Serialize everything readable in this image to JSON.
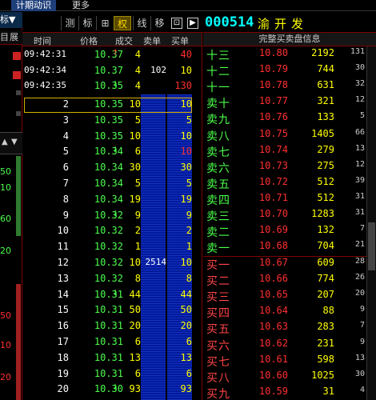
{
  "menubar": {
    "items": [
      {
        "label": "计期动识",
        "selected": true
      },
      {
        "label": "更多",
        "selected": false
      }
    ]
  },
  "left_strip": {
    "top_label": "标▼",
    "headers": [
      "目",
      "展"
    ],
    "values": [
      "50",
      "10",
      "60",
      "20",
      "50",
      "10",
      "20"
    ],
    "scroll_arrows": [
      "▲",
      "▼"
    ]
  },
  "toolbar": {
    "buttons": [
      "测",
      "标",
      "⊞",
      "权",
      "线",
      "移"
    ],
    "active": "权",
    "box_icons": [
      "⊡",
      "▶"
    ]
  },
  "stock": {
    "code": "000514",
    "name": "渝开发"
  },
  "tick_table": {
    "headers": [
      "时间",
      "价格",
      "成交",
      "卖单",
      "买单"
    ],
    "time_rows": [
      {
        "time": "09:42:31",
        "price": "10.37",
        "dir": "up",
        "vol": "4",
        "sell": "",
        "buy": "40",
        "buy_mark": "+"
      },
      {
        "time": "09:42:34",
        "price": "10.37",
        "dir": "",
        "vol": "4",
        "sell": "102",
        "buy": "10",
        "buy_mark": ""
      },
      {
        "time": "09:42:35",
        "price": "10.35",
        "dir": "down",
        "vol": "4",
        "sell": "",
        "buy": "130",
        "buy_mark": "+"
      }
    ],
    "index_rows": [
      {
        "idx": "2",
        "price": "10.35",
        "dir": "",
        "vol": "10",
        "buy": "10"
      },
      {
        "idx": "3",
        "price": "10.35",
        "dir": "",
        "vol": "5",
        "buy": "5"
      },
      {
        "idx": "4",
        "price": "10.35",
        "dir": "",
        "vol": "10",
        "buy": "10"
      },
      {
        "idx": "5",
        "price": "10.34",
        "dir": "down",
        "vol": "6",
        "buy": "10",
        "buy_mark": "+"
      },
      {
        "idx": "6",
        "price": "10.34",
        "dir": "",
        "vol": "30",
        "buy": "30"
      },
      {
        "idx": "7",
        "price": "10.34",
        "dir": "",
        "vol": "5",
        "buy": "5"
      },
      {
        "idx": "8",
        "price": "10.34",
        "dir": "",
        "vol": "19",
        "buy": "19"
      },
      {
        "idx": "9",
        "price": "10.32",
        "dir": "down",
        "vol": "9",
        "buy": "9"
      },
      {
        "idx": "10",
        "price": "10.32",
        "dir": "",
        "vol": "2",
        "buy": "2"
      },
      {
        "idx": "11",
        "price": "10.32",
        "dir": "",
        "vol": "1",
        "buy": "1"
      },
      {
        "idx": "12",
        "price": "10.32",
        "dir": "",
        "vol": "10",
        "sell": "2514",
        "buy": "10"
      },
      {
        "idx": "13",
        "price": "10.32",
        "dir": "",
        "vol": "8",
        "buy": "8"
      },
      {
        "idx": "14",
        "price": "10.31",
        "dir": "down",
        "vol": "44",
        "buy": "44"
      },
      {
        "idx": "15",
        "price": "10.31",
        "dir": "",
        "vol": "50",
        "buy": "50"
      },
      {
        "idx": "16",
        "price": "10.31",
        "dir": "",
        "vol": "20",
        "buy": "20"
      },
      {
        "idx": "17",
        "price": "10.31",
        "dir": "",
        "vol": "6",
        "buy": "6"
      },
      {
        "idx": "18",
        "price": "10.31",
        "dir": "",
        "vol": "13",
        "buy": "13"
      },
      {
        "idx": "19",
        "price": "10.31",
        "dir": "",
        "vol": "6",
        "buy": "6"
      },
      {
        "idx": "20",
        "price": "10.30",
        "dir": "down",
        "vol": "93",
        "buy": "93"
      }
    ]
  },
  "order_book": {
    "title": "完整买卖盘信息",
    "asks": [
      {
        "label": "十三",
        "price": "10.80",
        "vol": "2192",
        "cnt": "131"
      },
      {
        "label": "十二",
        "price": "10.79",
        "vol": "744",
        "cnt": "30"
      },
      {
        "label": "十一",
        "price": "10.78",
        "vol": "631",
        "cnt": "32"
      },
      {
        "label": "卖十",
        "price": "10.77",
        "vol": "321",
        "cnt": "12"
      },
      {
        "label": "卖九",
        "price": "10.76",
        "vol": "133",
        "cnt": "5"
      },
      {
        "label": "卖八",
        "price": "10.75",
        "vol": "1405",
        "cnt": "66"
      },
      {
        "label": "卖七",
        "price": "10.74",
        "vol": "279",
        "cnt": "13"
      },
      {
        "label": "卖六",
        "price": "10.73",
        "vol": "275",
        "cnt": "12"
      },
      {
        "label": "卖五",
        "price": "10.72",
        "vol": "512",
        "cnt": "39"
      },
      {
        "label": "卖四",
        "price": "10.71",
        "vol": "512",
        "cnt": "31"
      },
      {
        "label": "卖三",
        "price": "10.70",
        "vol": "1283",
        "cnt": "31"
      },
      {
        "label": "卖二",
        "price": "10.69",
        "vol": "132",
        "cnt": "7"
      },
      {
        "label": "卖一",
        "price": "10.68",
        "vol": "704",
        "cnt": "21"
      }
    ],
    "bids": [
      {
        "label": "买一",
        "price": "10.67",
        "vol": "609",
        "cnt": "28"
      },
      {
        "label": "买二",
        "price": "10.66",
        "vol": "774",
        "cnt": "26"
      },
      {
        "label": "买三",
        "price": "10.65",
        "vol": "207",
        "cnt": "20"
      },
      {
        "label": "买四",
        "price": "10.64",
        "vol": "88",
        "cnt": "9"
      },
      {
        "label": "买五",
        "price": "10.63",
        "vol": "283",
        "cnt": "7"
      },
      {
        "label": "买六",
        "price": "10.62",
        "vol": "231",
        "cnt": "9"
      },
      {
        "label": "买七",
        "price": "10.61",
        "vol": "598",
        "cnt": "13"
      },
      {
        "label": "买八",
        "price": "10.60",
        "vol": "1025",
        "cnt": "30"
      },
      {
        "label": "买九",
        "price": "10.59",
        "vol": "31",
        "cnt": "4"
      }
    ]
  },
  "colors": {
    "up": "#ff3030",
    "down": "#4cff4c",
    "volume": "#ffff00",
    "code": "#00ffff"
  }
}
